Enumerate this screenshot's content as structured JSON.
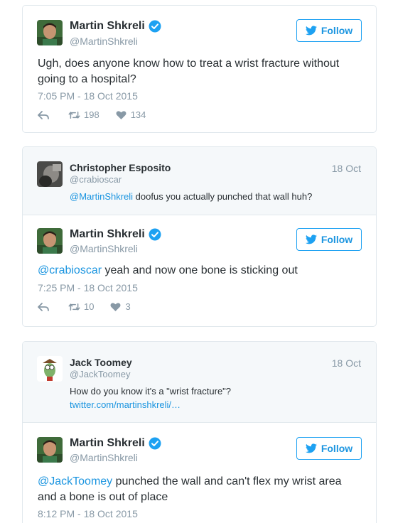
{
  "colors": {
    "link": "#1b95e0",
    "muted": "#8899a6",
    "text": "#292f33",
    "border": "#e1e8ed",
    "reply_bg": "#f5f8fa"
  },
  "card1": {
    "tweet": {
      "name": "Martin Shkreli",
      "handle": "@MartinShkreli",
      "follow_label": "Follow",
      "text": "Ugh, does anyone know how to treat a wrist fracture without going to a hospital?",
      "timestamp": "7:05 PM - 18 Oct 2015",
      "retweets": "198",
      "likes": "134"
    }
  },
  "card2": {
    "reply_to": {
      "name": "Christopher Esposito",
      "handle": "@crabioscar",
      "date": "18 Oct",
      "mention": "@MartinShkreli",
      "text": " doofus you actually punched that wall huh?"
    },
    "tweet": {
      "name": "Martin Shkreli",
      "handle": "@MartinShkreli",
      "follow_label": "Follow",
      "mention": "@crabioscar",
      "text": " yeah and now one bone is sticking out",
      "timestamp": "7:25 PM - 18 Oct 2015",
      "retweets": "10",
      "likes": "3"
    }
  },
  "card3": {
    "reply_to": {
      "name": "Jack Toomey",
      "handle": "@JackToomey",
      "date": "18 Oct",
      "text": "How do you know it's a \"wrist fracture\"?",
      "link": "twitter.com/martinshkreli/…"
    },
    "tweet": {
      "name": "Martin Shkreli",
      "handle": "@MartinShkreli",
      "follow_label": "Follow",
      "mention": "@JackToomey",
      "text": " punched the wall and can't flex my wrist area and a bone is out of place",
      "timestamp": "8:12 PM - 18 Oct 2015"
    }
  }
}
